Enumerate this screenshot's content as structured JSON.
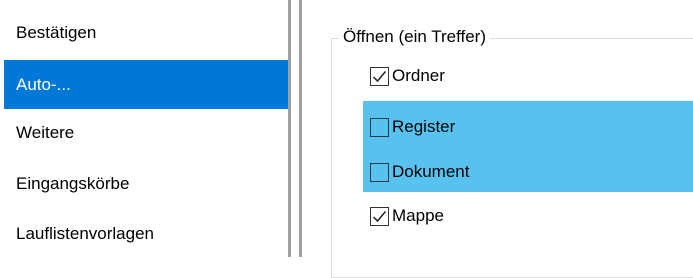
{
  "sidebar": {
    "items": [
      {
        "label": "Bestätigen",
        "selected": false
      },
      {
        "label": "Auto-...",
        "selected": true
      },
      {
        "label": "Weitere",
        "selected": false
      },
      {
        "label": "Eingangskörbe",
        "selected": false
      },
      {
        "label": "Lauflistenvorlagen",
        "selected": false
      }
    ]
  },
  "group": {
    "title": "Öffnen (ein Treffer)",
    "options": [
      {
        "label": "Ordner",
        "checked": true
      },
      {
        "label": "Register",
        "checked": false
      },
      {
        "label": "Dokument",
        "checked": false
      },
      {
        "label": "Mappe",
        "checked": true
      }
    ]
  },
  "colors": {
    "selection": "#0078d7",
    "highlight": "#58c2ee"
  }
}
